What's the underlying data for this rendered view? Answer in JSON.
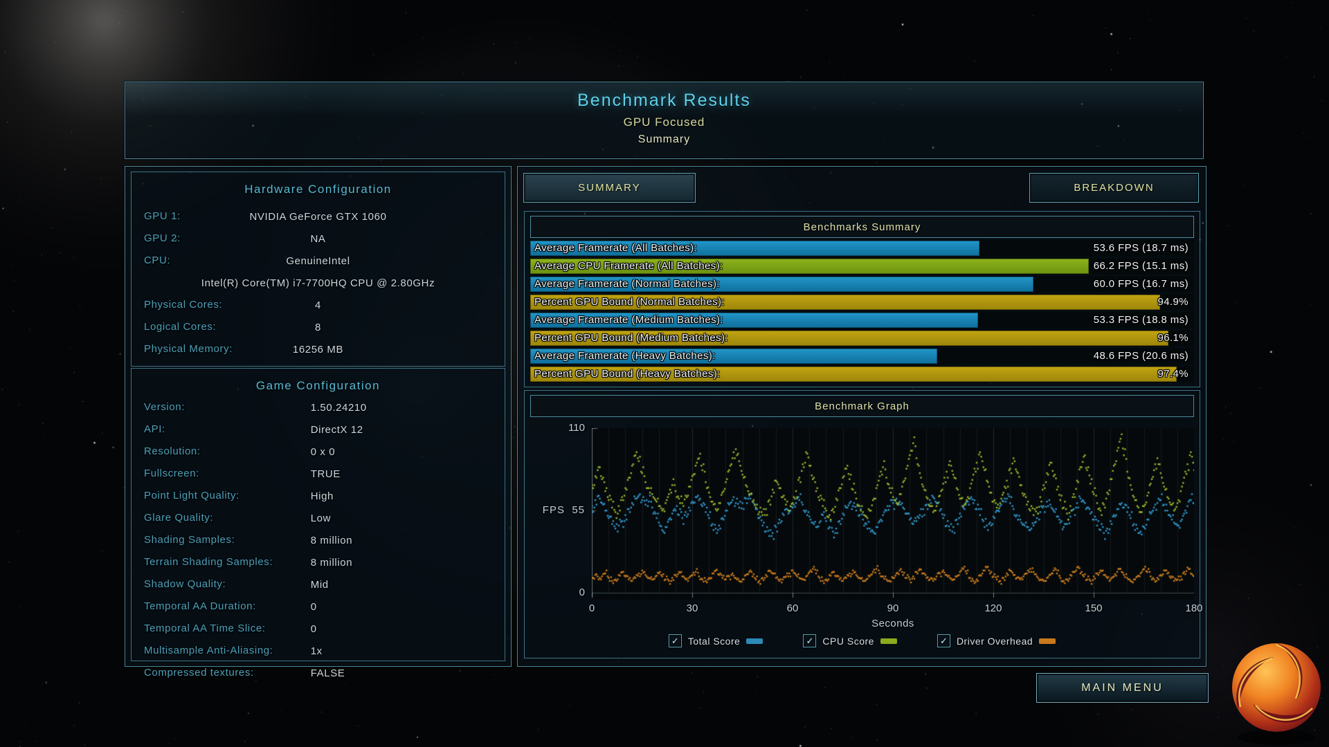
{
  "header": {
    "title": "Benchmark Results",
    "subtitle": "GPU Focused",
    "view": "Summary"
  },
  "hardware": {
    "title": "Hardware Configuration",
    "rows": [
      {
        "label": "GPU 1:",
        "value": "NVIDIA GeForce GTX 1060",
        "align": "center"
      },
      {
        "label": "GPU 2:",
        "value": "NA",
        "align": "center"
      },
      {
        "label": "CPU:",
        "value": "GenuineIntel",
        "align": "center"
      },
      {
        "label": "",
        "value": "Intel(R) Core(TM) i7-7700HQ CPU @ 2.80GHz",
        "align": "center"
      },
      {
        "label": "Physical Cores:",
        "value": "4",
        "align": "center"
      },
      {
        "label": "Logical Cores:",
        "value": "8",
        "align": "center"
      },
      {
        "label": "Physical Memory:",
        "value": "16256  MB",
        "align": "center"
      }
    ]
  },
  "game": {
    "title": "Game Configuration",
    "rows": [
      {
        "label": "Version:",
        "value": "1.50.24210",
        "align": "col"
      },
      {
        "label": "API:",
        "value": "DirectX 12",
        "align": "col"
      },
      {
        "label": "Resolution:",
        "value": "0 x 0",
        "align": "col"
      },
      {
        "label": "Fullscreen:",
        "value": "TRUE",
        "align": "col"
      },
      {
        "label": "Point Light Quality:",
        "value": "High",
        "align": "col"
      },
      {
        "label": "Glare Quality:",
        "value": "Low",
        "align": "col"
      },
      {
        "label": "Shading Samples:",
        "value": "8 million",
        "align": "col"
      },
      {
        "label": "Terrain Shading Samples:",
        "value": "8 million",
        "align": "col"
      },
      {
        "label": "Shadow Quality:",
        "value": "Mid",
        "align": "col"
      },
      {
        "label": "Temporal AA Duration:",
        "value": "0",
        "align": "col"
      },
      {
        "label": "Temporal AA Time Slice:",
        "value": "0",
        "align": "col"
      },
      {
        "label": "Multisample Anti-Aliasing:",
        "value": "1x",
        "align": "col"
      },
      {
        "label": "Compressed textures:",
        "value": "FALSE",
        "align": "col"
      }
    ]
  },
  "tabs": {
    "summary": "SUMMARY",
    "breakdown": "BREAKDOWN"
  },
  "summary_panel": {
    "title": "Benchmarks Summary",
    "rows": [
      {
        "label": "Average Framerate (All Batches):",
        "value": "53.6 FPS (18.7 ms)",
        "bar_pct": 67.7,
        "color": "blue"
      },
      {
        "label": "Average CPU Framerate (All Batches):",
        "value": "66.2 FPS (15.1 ms)",
        "bar_pct": 84.1,
        "color": "green"
      },
      {
        "label": "Average Framerate (Normal Batches):",
        "value": "60.0 FPS (16.7 ms)",
        "bar_pct": 75.8,
        "color": "blue"
      },
      {
        "label": "Percent GPU Bound (Normal Batches):",
        "value": "94.9%",
        "bar_pct": 94.9,
        "color": "gold"
      },
      {
        "label": "Average Framerate (Medium Batches):",
        "value": "53.3 FPS (18.8 ms)",
        "bar_pct": 67.5,
        "color": "blue"
      },
      {
        "label": "Percent GPU Bound (Medium Batches):",
        "value": "96.1%",
        "bar_pct": 96.1,
        "color": "gold"
      },
      {
        "label": "Average Framerate (Heavy Batches):",
        "value": "48.6 FPS (20.6 ms)",
        "bar_pct": 61.3,
        "color": "blue"
      },
      {
        "label": "Percent GPU Bound (Heavy Batches):",
        "value": "97.4%",
        "bar_pct": 97.4,
        "color": "gold"
      }
    ]
  },
  "graph": {
    "title": "Benchmark Graph",
    "y_axis_label": "FPS",
    "y_top": "110",
    "y_mid": "55",
    "y_bottom": "0",
    "xticks": [
      "0",
      "30",
      "60",
      "90",
      "120",
      "150",
      "180"
    ],
    "xlabel": "Seconds",
    "legend": [
      {
        "label": "Total Score",
        "color": "#2d8ab8",
        "checked": true
      },
      {
        "label": "CPU Score",
        "color": "#8aab1e",
        "checked": true
      },
      {
        "label": "Driver Overhead",
        "color": "#c8791c",
        "checked": true
      }
    ]
  },
  "chart_data": {
    "type": "scatter",
    "title": "Benchmark Graph",
    "xlabel": "Seconds",
    "ylabel": "FPS",
    "xlim": [
      0,
      180
    ],
    "ylim": [
      0,
      110
    ],
    "x_step": 1,
    "grid": "vertical-every-5s",
    "legend_position": "bottom",
    "series": [
      {
        "name": "Total Score",
        "color": "#2f94c8",
        "values": [
          58,
          62,
          65,
          60,
          55,
          50,
          46,
          43,
          45,
          48,
          52,
          56,
          60,
          63,
          65,
          62,
          59,
          61,
          57,
          53,
          47,
          42,
          44,
          49,
          53,
          55,
          52,
          50,
          54,
          57,
          61,
          64,
          62,
          58,
          54,
          50,
          46,
          43,
          45,
          50,
          55,
          59,
          62,
          60,
          57,
          60,
          63,
          65,
          61,
          56,
          50,
          45,
          41,
          38,
          40,
          44,
          49,
          53,
          56,
          54,
          57,
          60,
          62,
          59,
          55,
          51,
          47,
          44,
          47,
          52,
          48,
          44,
          41,
          43,
          48,
          53,
          57,
          60,
          58,
          55,
          52,
          49,
          46,
          43,
          41,
          44,
          48,
          52,
          55,
          58,
          60,
          63,
          61,
          57,
          53,
          49,
          46,
          48,
          52,
          56,
          59,
          62,
          64,
          60,
          55,
          50,
          45,
          42,
          44,
          49,
          53,
          57,
          61,
          63,
          60,
          56,
          52,
          48,
          45,
          47,
          51,
          55,
          58,
          61,
          63,
          60,
          56,
          52,
          49,
          46,
          44,
          42,
          45,
          50,
          54,
          58,
          61,
          59,
          55,
          51,
          47,
          44,
          46,
          51,
          56,
          60,
          63,
          61,
          57,
          53,
          49,
          45,
          42,
          40,
          43,
          48,
          52,
          56,
          59,
          57,
          54,
          50,
          46,
          43,
          41,
          44,
          49,
          53,
          57,
          60,
          62,
          59,
          55,
          51,
          47,
          45,
          48,
          53,
          58,
          62,
          60
        ]
      },
      {
        "name": "CPU Score",
        "color": "#97b42a",
        "values": [
          72,
          78,
          84,
          76,
          68,
          62,
          57,
          54,
          58,
          64,
          70,
          77,
          85,
          92,
          88,
          80,
          74,
          70,
          66,
          62,
          58,
          55,
          60,
          66,
          72,
          68,
          63,
          60,
          65,
          71,
          78,
          85,
          90,
          82,
          74,
          67,
          61,
          56,
          60,
          67,
          74,
          82,
          90,
          96,
          88,
          79,
          72,
          66,
          61,
          57,
          54,
          52,
          56,
          62,
          69,
          75,
          70,
          64,
          59,
          55,
          60,
          68,
          77,
          86,
          94,
          85,
          76,
          68,
          62,
          58,
          55,
          52,
          56,
          63,
          70,
          77,
          83,
          76,
          69,
          63,
          58,
          54,
          51,
          55,
          62,
          70,
          78,
          84,
          77,
          70,
          64,
          60,
          66,
          74,
          83,
          92,
          100,
          90,
          80,
          71,
          64,
          58,
          54,
          58,
          65,
          73,
          81,
          88,
          79,
          70,
          63,
          58,
          62,
          70,
          79,
          87,
          94,
          84,
          75,
          67,
          61,
          57,
          60,
          67,
          75,
          83,
          90,
          81,
          72,
          65,
          59,
          55,
          52,
          57,
          64,
          72,
          80,
          87,
          78,
          69,
          62,
          57,
          53,
          58,
          66,
          75,
          84,
          91,
          82,
          73,
          66,
          60,
          55,
          59,
          67,
          76,
          85,
          95,
          103,
          92,
          81,
          72,
          64,
          58,
          54,
          58,
          65,
          73,
          82,
          90,
          80,
          71,
          64,
          59,
          55,
          60,
          68,
          77,
          86,
          94,
          82
        ]
      },
      {
        "name": "Driver Overhead",
        "color": "#c97a1c",
        "values": [
          10,
          12,
          9,
          11,
          13,
          10,
          8,
          9,
          12,
          14,
          11,
          9,
          8,
          10,
          13,
          15,
          12,
          10,
          9,
          11,
          13,
          11,
          9,
          8,
          10,
          12,
          14,
          11,
          9,
          10,
          12,
          14,
          11,
          9,
          8,
          10,
          13,
          15,
          12,
          10,
          9,
          11,
          13,
          10,
          8,
          9,
          12,
          14,
          11,
          9,
          8,
          10,
          12,
          15,
          13,
          10,
          8,
          9,
          11,
          13,
          15,
          12,
          10,
          9,
          11,
          14,
          16,
          13,
          10,
          8,
          9,
          12,
          14,
          11,
          9,
          8,
          10,
          13,
          15,
          12,
          10,
          8,
          9,
          11,
          14,
          16,
          13,
          11,
          9,
          8,
          10,
          13,
          15,
          12,
          10,
          9,
          11,
          14,
          16,
          13,
          10,
          9,
          8,
          11,
          13,
          15,
          12,
          10,
          9,
          11,
          14,
          16,
          13,
          10,
          8,
          9,
          12,
          15,
          17,
          13,
          11,
          9,
          8,
          10,
          13,
          15,
          12,
          10,
          9,
          11,
          13,
          16,
          14,
          11,
          9,
          8,
          10,
          12,
          15,
          13,
          10,
          8,
          9,
          12,
          14,
          17,
          13,
          11,
          9,
          8,
          11,
          13,
          15,
          12,
          10,
          9,
          11,
          14,
          16,
          12,
          10,
          8,
          9,
          11,
          13,
          16,
          14,
          11,
          9,
          10,
          12,
          15,
          13,
          10,
          8,
          9,
          11,
          14,
          17,
          13,
          11
        ]
      }
    ]
  },
  "footer": {
    "main_menu": "MAIN MENU"
  },
  "colors": {
    "accent_cyan": "#5ed0ea",
    "khaki_text": "#dde0a8",
    "bar_blue": "#1685b6",
    "bar_green": "#7ea414",
    "bar_gold": "#ad930e",
    "panel_border": "#4d8b9d"
  }
}
